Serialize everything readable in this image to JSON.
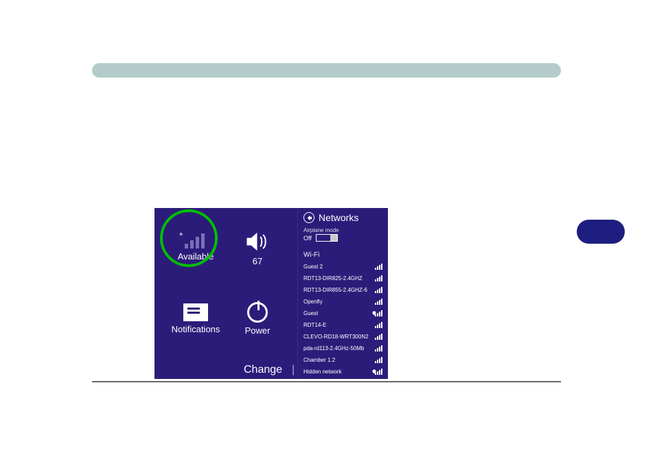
{
  "tiles": {
    "network": {
      "label": "Available"
    },
    "volume": {
      "label": "67"
    },
    "notifications": {
      "label": "Notifications"
    },
    "power": {
      "label": "Power"
    }
  },
  "change_link": "Change",
  "panel": {
    "title": "Networks",
    "airplane_label": "Airplane mode",
    "airplane_state": "Off",
    "wifi_section": "Wi-Fi",
    "networks": [
      {
        "name": "Guest 2",
        "secure": false
      },
      {
        "name": "RDT13-DIR825-2.4GHZ",
        "secure": false
      },
      {
        "name": "RDT13-DIR855-2.4GHZ-6",
        "secure": false
      },
      {
        "name": "Openfly",
        "secure": false
      },
      {
        "name": "Guest",
        "secure": true
      },
      {
        "name": "RDT14-E",
        "secure": false
      },
      {
        "name": "CLEVO-RD18-WRT300N2",
        "secure": false
      },
      {
        "name": "pda-rd113-2.4GHz-50Mb",
        "secure": false
      },
      {
        "name": "Chamber 1.2",
        "secure": false
      },
      {
        "name": "Hidden network",
        "secure": true
      }
    ]
  }
}
